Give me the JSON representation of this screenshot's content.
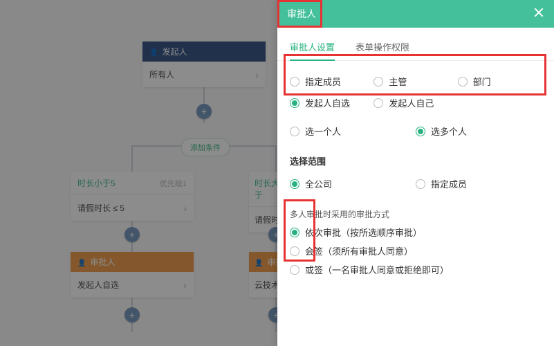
{
  "flow": {
    "start": {
      "header": "发起人",
      "body": "所有人"
    },
    "addCondition": "添加条件",
    "cond1": {
      "title": "时长小于5",
      "priority": "优先级1",
      "body": "请假时长 ≤ 5"
    },
    "cond2": {
      "title": "时长大于",
      "body": "请假时"
    },
    "approver1": {
      "header": "审批人",
      "body": "发起人自选"
    },
    "approver2": {
      "header": "审批",
      "body": "云技术"
    }
  },
  "panel": {
    "title": "审批人",
    "tabs": {
      "settings": "审批人设置",
      "form": "表单操作权限"
    },
    "typeOptions": {
      "member": "指定成员",
      "supervisor": "主管",
      "dept": "部门",
      "selfChoose": "发起人自选",
      "self": "发起人自己"
    },
    "countOptions": {
      "one": "选一个人",
      "many": "选多个人"
    },
    "scopeTitle": "选择范围",
    "scopeOptions": {
      "company": "全公司",
      "members": "指定成员"
    },
    "methodLabel": "多人审批时采用的审批方式",
    "methodOptions": {
      "seq": "依次审批（按所选顺序审批）",
      "and": "会签（须所有审批人同意）",
      "or": "或签（一名审批人同意或拒绝即可）"
    }
  }
}
